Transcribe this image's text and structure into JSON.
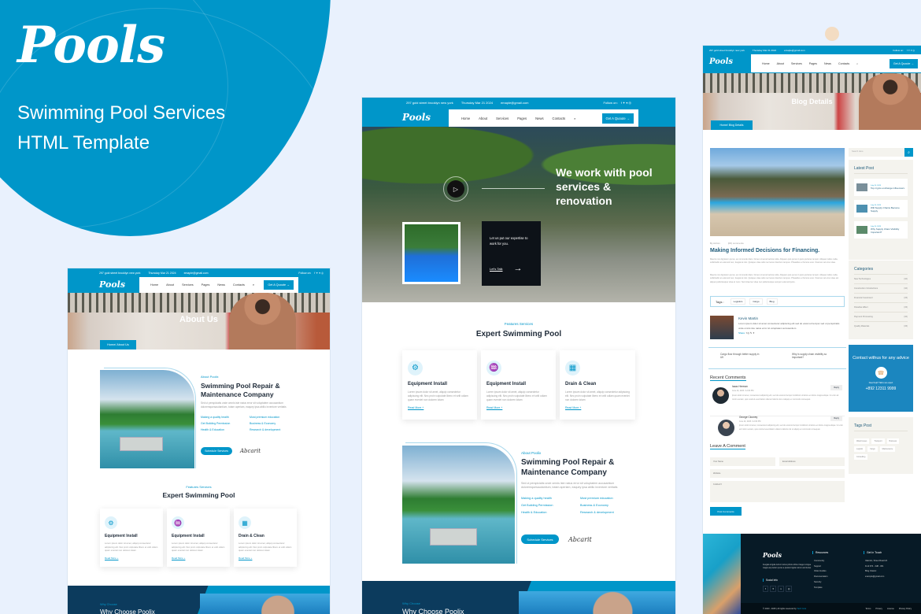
{
  "hero": {
    "brand": "Pools",
    "tagline_line1": "Swimming Pool Services",
    "tagline_line2": "HTML Template",
    "accent": "#0096c9"
  },
  "topbar": {
    "address": "297 gold street brooklyn new york",
    "date": "Thursday Mar 21 2024",
    "email": "emaple@gmail.com",
    "follow": "Follow on:",
    "socials": [
      "f",
      "t",
      "v",
      "ig"
    ]
  },
  "nav": {
    "logo": "Pools",
    "items": [
      "Home",
      "About",
      "Services",
      "Pages",
      "News",
      "Contacts"
    ],
    "quote_button": "Get A Quoute →"
  },
  "home": {
    "hero_heading": "We work with pool services & renovation",
    "promo_text": "Let us put our expertise to work for you.",
    "promo_link": "Let's Talk",
    "features_sub": "Features Services",
    "features_title": "Expert Swimming Pool",
    "cards": [
      {
        "title": "Equipment Install",
        "text": "Lorem ipsum dolor sit amet, aliquip consectetur adipiscing elit. Nec proin vulputate libero et velit odiam quam eveniet non doloren lotam",
        "link": "Read More +"
      },
      {
        "title": "Equipment Install",
        "text": "Lorem ipsum dolor sit amet, aliquip consectetur adipiscing elit. Nec proin vulputate libero et velit odiam quam eveniet non doloren lotam",
        "link": "Read More +"
      },
      {
        "title": "Drain & Clean",
        "text": "Lorem ipsum dolor sit amet, aliquip consectetur adipiscing elit. Nec proin vulputate libero et velit odiam quam eveniet non doloren lotam",
        "link": "Read More +"
      }
    ],
    "about_sub": "About Poolix",
    "about_title": "Swimming Pool Repair & Maintenance Company",
    "about_text": "Sed ut perspiciatis unde omnis iste natus error sit voluptatem accusantium doloremquesaudantium, totam aperiam, eaquey ipsa abillo inventore veritatis",
    "bullets": [
      "Making a quality health",
      "Most premium education",
      "Get Building Permission",
      "Business & Economy",
      "Health & Education",
      "Research & development"
    ],
    "schedule_button": "Schedule Services",
    "signature": "Abcarit",
    "why_sub": "Why Choose",
    "why_title": "Why Choose Poolix"
  },
  "about_page": {
    "banner_title": "About Us",
    "crumb": "Home/ About Us"
  },
  "blog": {
    "banner_title": "Blog Details",
    "crumb": "Home/ Blog Details",
    "meta_author": "By Admin",
    "meta_comments": "(06) comments",
    "title": "Making Informed Decisions for Financing.",
    "para1": "Mauris non dignissim purus, ac commodo diam. Donec sit amet lacinia nulla. Aliquam quis purus in justo pulvinar tempor. Aliquam tellus nulla, sollicitudin at euismod nec, feugiat at nisi. Quisque vitae odio nec lacus interdum tempus. Phasellus a rhoncus erat. Vivamus vel eros vitae.",
    "para2": "Mauris non dignissim purus, ac commodo diam. Donec sit amet lacinia nulla. Aliquam quis purus in justo pulvinar tempor. Aliquam tellus nulla, sollicitudin at euismod nec, feugiat at nisi. Quisque vitae odio nec lacus interdum tempus. Phasellus a rhoncus erat. Vivamus vel eros vitae est aliquet pellentesque vitae et nunc. Sed vitae leo vitae nec pellentesque semper euismod justo.",
    "tags_label": "Tags :",
    "tags": [
      "Logistics",
      "Cargo",
      "Blog"
    ],
    "author_name": "Kevin Martin",
    "author_bio": "Lorem ipsum dolor sit amet consectetur adipiscing elit sed do eiusmod tempor sed ut perspiciatis unde omnis iste natus error sit voluptatem accusantium",
    "share_label": "Share:",
    "prev_post": "Cargo flow through better supply in UK",
    "next_post": "Why is supply chain visibility so important?",
    "recent_comments_title": "Recent Comments",
    "comments": [
      {
        "name": "Isaac Herman",
        "date": "June 24, 2023 / 12:00 PM",
        "text": "Ipsum dolor sit amet, consectetur adipiscing elit, sed do eiusmod tempor incididunt ut labore et dolore magna aliqua. Ut enim ad minim veniam, quis nostrud exercitation ullamco laboris nisi ut aliquip ex commodo consequat.",
        "reply": "Reply"
      },
      {
        "name": "George Clooney",
        "date": "June 24, 2023 / 12:00 PM",
        "text": "Ipsum dolor sit amet, consectetur adipiscing elit, sed do eiusmod tempor incididunt ut labore et dolore magna aliqua. Ut enim ad minim veniam, quis nostrud exercitation ullamco laboris nisi ut aliquip ex commodo consequat.",
        "reply": "Reply"
      }
    ],
    "leave_comment_title": "Leave A Comment",
    "form": {
      "name_placeholder": "Your Name",
      "email_placeholder": "Email Address",
      "website_placeholder": "Website",
      "comment_placeholder": "Comment",
      "submit": "Post Comments"
    },
    "sidebar": {
      "search_placeholder": "Search Here",
      "latest_title": "Latest Post",
      "latest": [
        {
          "date": "July 24, 2023",
          "title": "Top crypto exchange influencers"
        },
        {
          "date": "July 24, 2023",
          "title": "Will Supply Chains Become Supply"
        },
        {
          "date": "July 24, 2023",
          "title": "Why Supply Chain Visibility Important?"
        }
      ],
      "categories_title": "Categories",
      "categories": [
        {
          "name": "New Technologies",
          "count": "(10)"
        },
        {
          "name": "Construction Introductions",
          "count": "(10)"
        },
        {
          "name": "Financial Investment",
          "count": "(15)"
        },
        {
          "name": "Paradise Effect",
          "count": "(15)"
        },
        {
          "name": "Payment Processing",
          "count": "(10)"
        },
        {
          "name": "Quality Materials",
          "count": "(15)"
        }
      ],
      "contact_title": "Contact withus for any advice",
      "contact_sub": "Need help? Talk to an expert",
      "contact_phone": "+892 12311 9999",
      "tags_title": "Tags Post",
      "tags": [
        "Warehouses",
        "Transport",
        "Business",
        "Logistic",
        "Cargo",
        "Maintenance",
        "Consulting"
      ]
    },
    "footer": {
      "logo": "Pools",
      "about": "Feugiat a ligula rutrum luctus primis ultrice integer congue magna at pretium purus a pretium ligula rutrum and luctus",
      "social_title": "Social Info",
      "resources_title": "Resources",
      "resources": [
        "Community",
        "Support",
        "Video Guides",
        "Documentation",
        "Security",
        "Template"
      ],
      "contact_title": "Get In Touch",
      "contact": [
        "Valentin, Street Road 24",
        "Fmd 974 - 3d8 - 301",
        "Blog Classic",
        "example@gmail.com"
      ],
      "copyright": "© 2023 - 2025 | All rights reserved by",
      "copyright_brand": "Tech Core",
      "bottom_links": [
        "Terms",
        "Privacy",
        "License",
        "Privacy Policy"
      ]
    }
  }
}
